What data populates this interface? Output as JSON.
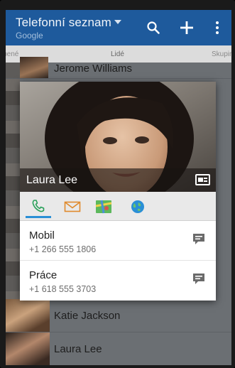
{
  "app": {
    "title": "Telefonní seznam",
    "account": "Google"
  },
  "tabs": {
    "left": "oblíbené",
    "center": "Lidé",
    "right": "Skupiny"
  },
  "list": {
    "rows": [
      {
        "name": "Jerome Williams"
      },
      {
        "name": "Katie Jackson"
      },
      {
        "name": "Laura Lee"
      }
    ]
  },
  "card": {
    "name": "Laura Lee",
    "entries": [
      {
        "label": "Mobil",
        "number": "+1 266 555 1806"
      },
      {
        "label": "Práce",
        "number": "+1 618 555 3703"
      }
    ]
  },
  "icons": {
    "search": "search-icon",
    "add": "plus-icon",
    "overflow": "more-vert-icon",
    "phone": "phone-icon",
    "mail": "mail-icon",
    "map": "map-icon",
    "web": "globe-icon",
    "vcard": "contact-card-icon",
    "message": "message-icon"
  },
  "colors": {
    "actionbar": "#1e5a9c",
    "tab_indicator": "#2a8fd6"
  }
}
